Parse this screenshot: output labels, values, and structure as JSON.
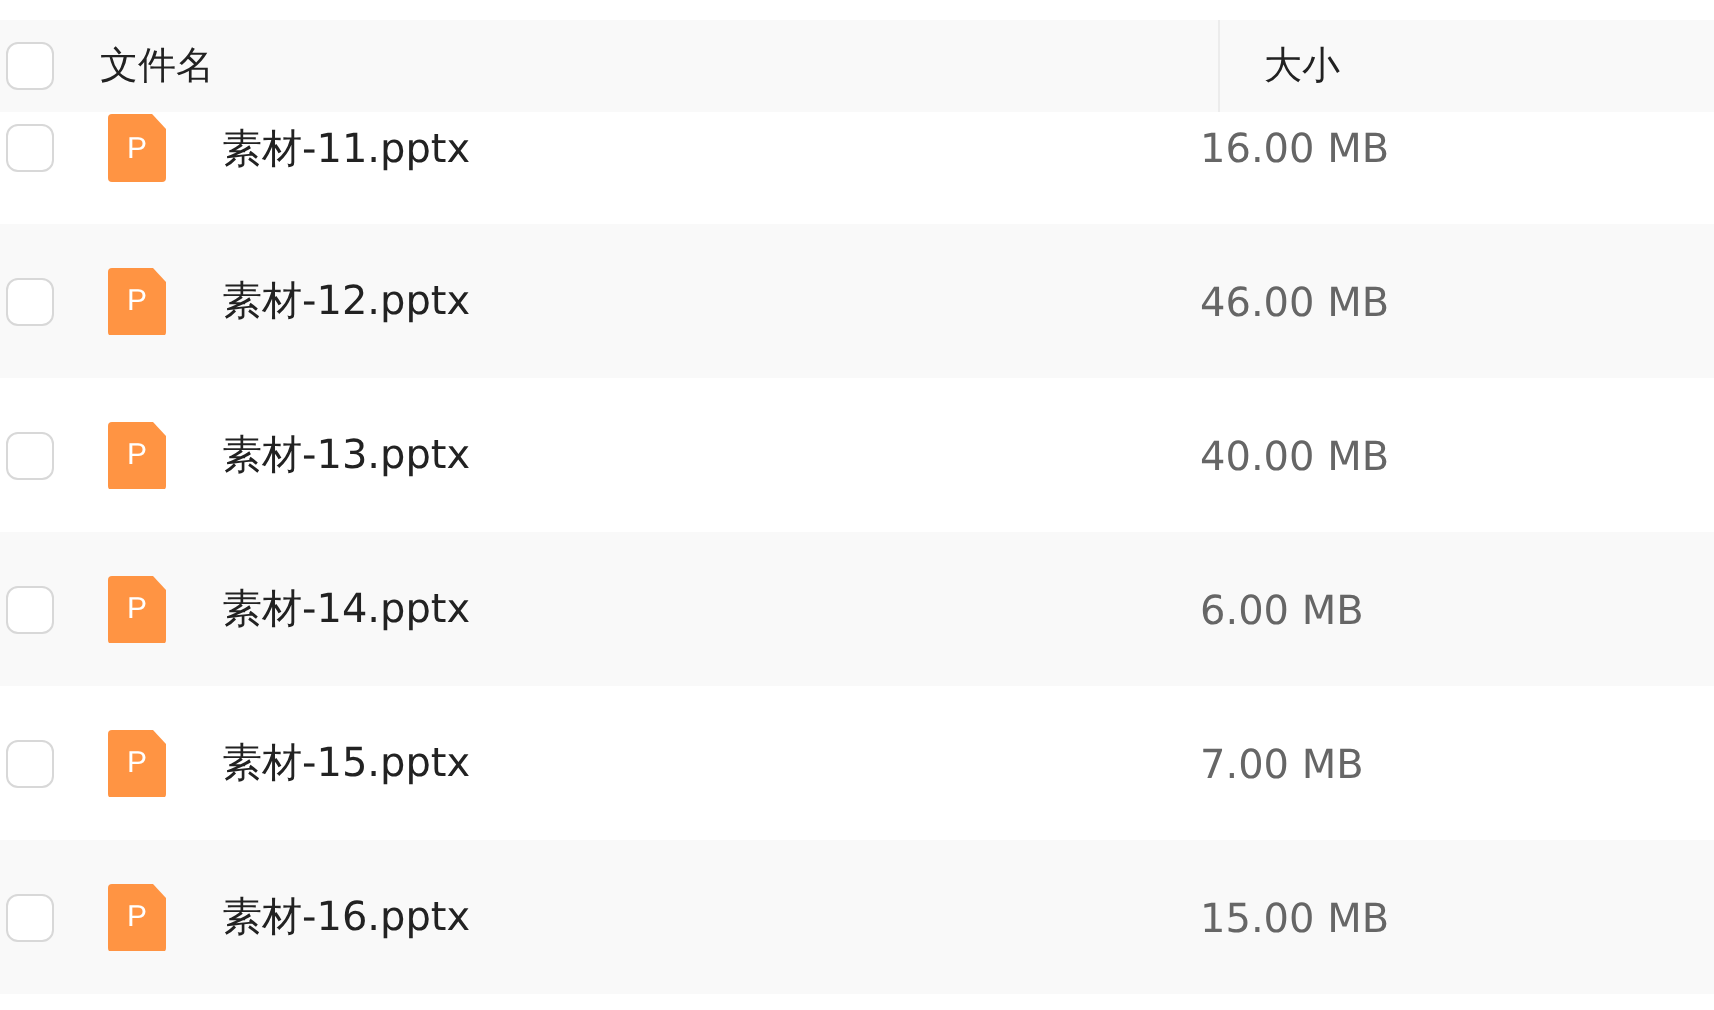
{
  "header": {
    "checked": false,
    "columns": [
      "文件名",
      "大小"
    ]
  },
  "files": [
    {
      "name": "素材-11.pptx",
      "size": "16.00 MB",
      "icon_text": "P",
      "checked": false
    },
    {
      "name": "素材-12.pptx",
      "size": "46.00 MB",
      "icon_text": "P",
      "checked": false
    },
    {
      "name": "素材-13.pptx",
      "size": "40.00 MB",
      "icon_text": "P",
      "checked": false
    },
    {
      "name": "素材-14.pptx",
      "size": "6.00 MB",
      "icon_text": "P",
      "checked": false
    },
    {
      "name": "素材-15.pptx",
      "size": "7.00 MB",
      "icon_text": "P",
      "checked": false
    },
    {
      "name": "素材-16.pptx",
      "size": "15.00 MB",
      "icon_text": "P",
      "checked": false
    }
  ]
}
